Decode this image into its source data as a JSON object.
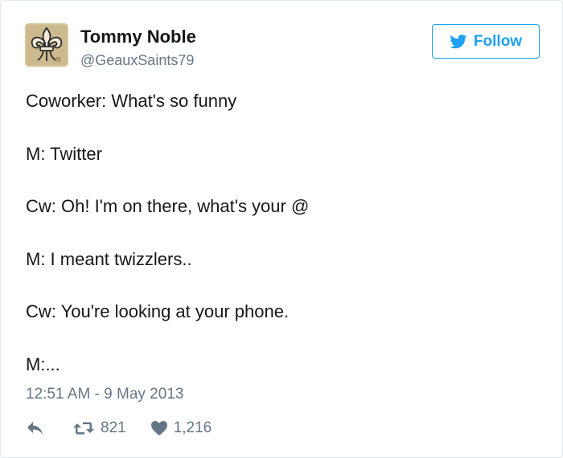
{
  "user": {
    "name": "Tommy Noble",
    "handle": "@GeauxSaints79"
  },
  "follow_button": {
    "label": "Follow"
  },
  "tweet": {
    "lines": [
      "Coworker: What's so funny",
      "M: Twitter",
      "Cw: Oh! I'm on there, what's your @",
      "M: I meant twizzlers..",
      "Cw: You're looking at your phone.",
      "M:..."
    ],
    "timestamp": "12:51 AM - 9 May 2013"
  },
  "actions": {
    "reply_icon": "reply-icon",
    "retweet_icon": "retweet-icon",
    "retweet_count": "821",
    "like_icon": "heart-icon",
    "like_count": "1,216"
  },
  "colors": {
    "accent": "#1da1f2",
    "text": "#14171a",
    "secondary": "#657786",
    "border": "#e1e8ed"
  }
}
